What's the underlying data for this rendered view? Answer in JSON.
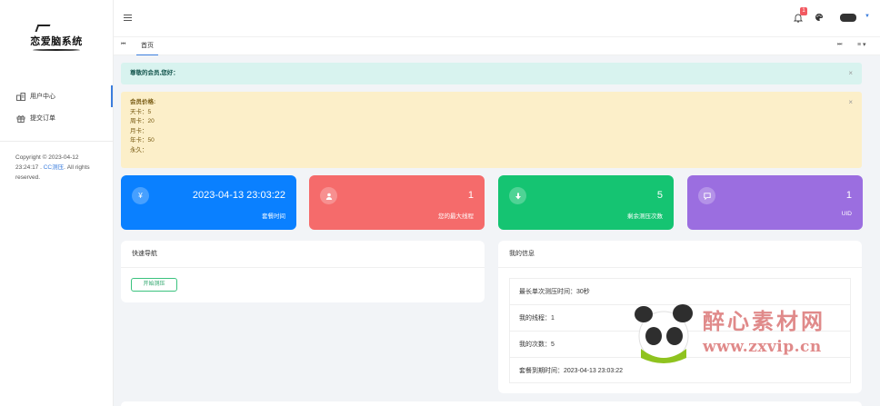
{
  "sidebar": {
    "logo_text": "恋爱脑系统",
    "items": [
      {
        "icon": "dashboard-icon",
        "label": "用户中心"
      },
      {
        "icon": "gift-icon",
        "label": "提交订单"
      }
    ],
    "copyright_prefix": "Copyright © 2023-04-12 23:24:17 . ",
    "copyright_link": "CC测压",
    "copyright_suffix": ". All rights reserved."
  },
  "topbar": {
    "notification_count": "1"
  },
  "tabs": {
    "home_label": "首页"
  },
  "alerts": {
    "greeting": "尊敬的会员,您好：",
    "pricing_title": "会员价格:",
    "pricing_lines": [
      "天卡：5",
      "周卡：20",
      "月卡：",
      "年卡：50",
      "永久："
    ]
  },
  "stats": [
    {
      "icon": "yen-icon",
      "value": "2023-04-13 23:03:22",
      "label": "套餐时间",
      "color": "#0a80ff"
    },
    {
      "icon": "user-icon",
      "value": "1",
      "label": "您的最大线程",
      "color": "#f56b6b"
    },
    {
      "icon": "download-icon",
      "value": "5",
      "label": "剩余测压次数",
      "color": "#15c472"
    },
    {
      "icon": "chat-icon",
      "value": "1",
      "label": "UID",
      "color": "#9b6ee0"
    }
  ],
  "quick_nav": {
    "title": "快速导航",
    "button_label": "开始测压"
  },
  "my_info": {
    "title": "我的信息",
    "rows": [
      "最长单次测压时间：30秒",
      "我的线程：1",
      "我的次数：5",
      "套餐到期时间：2023-04-13 23:03:22"
    ]
  },
  "watermark": {
    "title": "醉心素材网",
    "url": "www.zxvip.cn"
  }
}
